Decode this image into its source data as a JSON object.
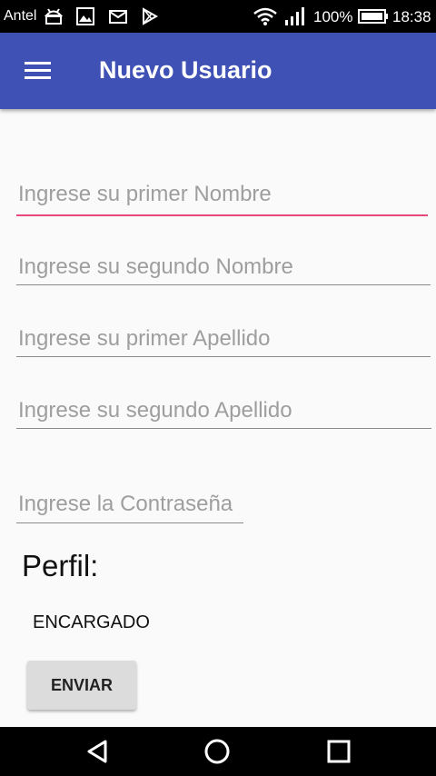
{
  "status_bar": {
    "carrier": "Antel",
    "battery_percent": "100%",
    "time": "18:38",
    "icons": [
      "android-debug-icon",
      "image-icon",
      "mail-icon",
      "play-store-icon",
      "wifi-icon",
      "signal-icon",
      "battery-icon"
    ]
  },
  "app_bar": {
    "title": "Nuevo Usuario",
    "background": "#3f51b5",
    "menu_icon": "hamburger-menu-icon"
  },
  "form": {
    "first_name_placeholder": "Ingrese su primer Nombre",
    "second_name_placeholder": "Ingrese su segundo Nombre",
    "first_surname_placeholder": "Ingrese su primer Apellido",
    "second_surname_placeholder": "Ingrese su segundo Apellido",
    "password_placeholder": "Ingrese la Contraseña",
    "focus_color": "#e84879"
  },
  "profile": {
    "label": "Perfil:",
    "selected": "ENCARGADO"
  },
  "send_button": "ENVIAR",
  "nav_bar": {
    "icons": [
      "back-icon",
      "home-icon",
      "recents-icon"
    ]
  }
}
